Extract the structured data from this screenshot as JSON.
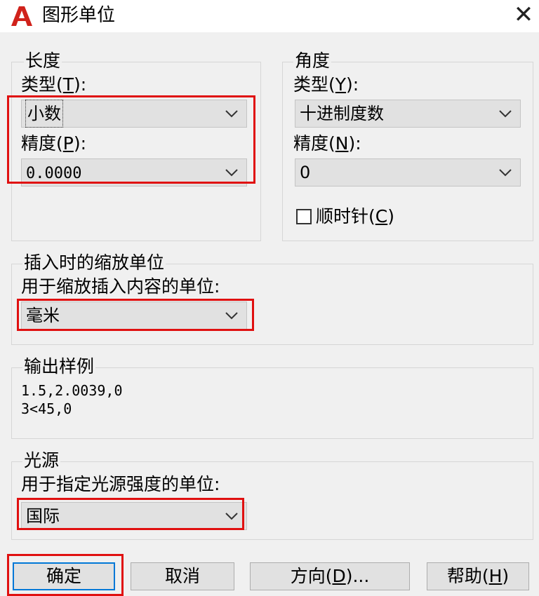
{
  "window": {
    "title": "图形单位",
    "close_glyph": "✕"
  },
  "length": {
    "group_title": "长度",
    "type_label_pre": "类型(",
    "type_label_key": "T",
    "type_label_post": "):",
    "type_value": "小数",
    "precision_label_pre": "精度(",
    "precision_label_key": "P",
    "precision_label_post": "):",
    "precision_value": "0.0000"
  },
  "angle": {
    "group_title": "角度",
    "type_label_pre": "类型(",
    "type_label_key": "Y",
    "type_label_post": "):",
    "type_value": "十进制度数",
    "precision_label_pre": "精度(",
    "precision_label_key": "N",
    "precision_label_post": "):",
    "precision_value": "0",
    "clockwise_label_pre": "顺时针(",
    "clockwise_label_key": "C",
    "clockwise_label_post": ")",
    "clockwise_checked": false
  },
  "insertion": {
    "group_title": "插入时的缩放单位",
    "label": "用于缩放插入内容的单位:",
    "value": "毫米"
  },
  "sample_output": {
    "group_title": "输出样例",
    "lines": [
      "1.5,2.0039,0",
      "3<45,0"
    ]
  },
  "lighting": {
    "group_title": "光源",
    "label": "用于指定光源强度的单位:",
    "value": "国际"
  },
  "buttons": {
    "ok": "确定",
    "cancel": "取消",
    "direction_pre": "方向(",
    "direction_key": "D",
    "direction_post": ")...",
    "help_pre": "帮助(",
    "help_key": "H",
    "help_post": ")"
  },
  "colors": {
    "highlight_box": "#e01010",
    "default_button_border": "#0078d7",
    "autocad_red": "#d0221b"
  },
  "icons": {
    "app": "autocad-logo-icon",
    "close": "close-icon",
    "dropdown": "chevron-down-icon"
  }
}
